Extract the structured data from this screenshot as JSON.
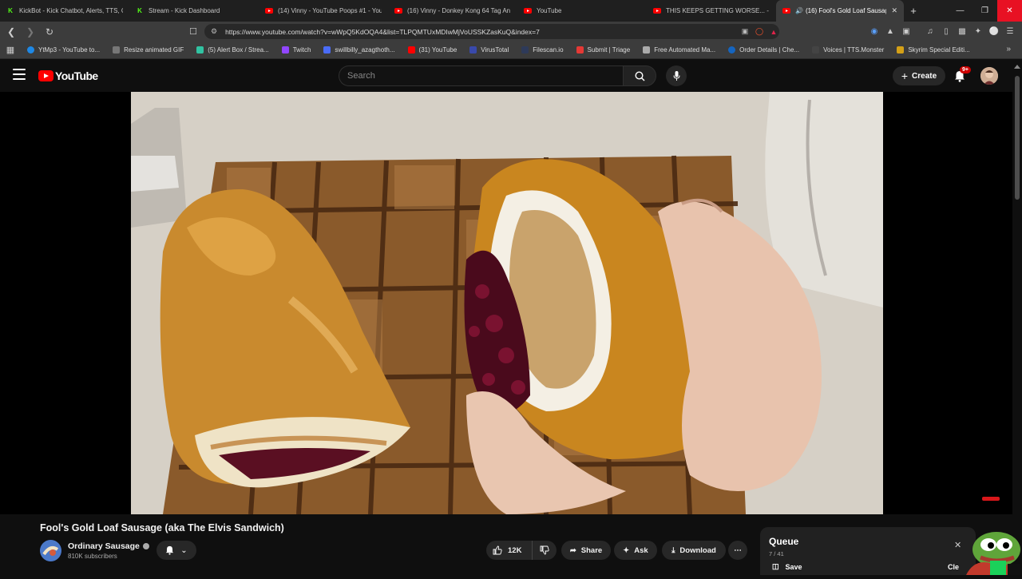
{
  "browser": {
    "tabs": [
      {
        "title": "KickBot - Kick Chatbot, Alerts, TTS, C",
        "icon": "kick-icon",
        "color": "#53fc18",
        "active": false
      },
      {
        "title": "Stream - Kick Dashboard",
        "icon": "kick-icon",
        "color": "#53fc18",
        "active": false
      },
      {
        "title": "(14) Vinny - YouTube Poops #1 - You",
        "icon": "youtube-icon",
        "color": "#ff0000",
        "active": false
      },
      {
        "title": "(16) Vinny - Donkey Kong 64 Tag An",
        "icon": "youtube-icon",
        "color": "#ff0000",
        "active": false
      },
      {
        "title": "YouTube",
        "icon": "youtube-icon",
        "color": "#ff0000",
        "active": false
      },
      {
        "title": "THIS KEEPS GETTING WORSE... - You",
        "icon": "youtube-icon",
        "color": "#ff0000",
        "active": false
      },
      {
        "title": "(16) Fool's Gold Loaf Sausag",
        "icon": "youtube-icon",
        "color": "#ff0000",
        "active": true
      }
    ],
    "url": "https://www.youtube.com/watch?v=wWpQ5KdOQA4&list=TLPQMTUxMDIwMjVoUSSKZasKuQ&index=7",
    "bookmarks": [
      {
        "label": "YtMp3 - YouTube to...",
        "color": "#1e88e5"
      },
      {
        "label": "Resize animated GIF",
        "color": "#777777"
      },
      {
        "label": "(5) Alert Box / Strea...",
        "color": "#31c3a2"
      },
      {
        "label": "Twitch",
        "color": "#9146ff"
      },
      {
        "label": "swillbilly_azagthoth...",
        "color": "#4a6cf7"
      },
      {
        "label": "(31) YouTube",
        "color": "#ff0000"
      },
      {
        "label": "VirusTotal",
        "color": "#3949ab"
      },
      {
        "label": "Filescan.io",
        "color": "#2e3a59"
      },
      {
        "label": "Submit | Triage",
        "color": "#e53935"
      },
      {
        "label": "Free Automated Ma...",
        "color": "#aaaaaa"
      },
      {
        "label": "Order Details | Che...",
        "color": "#1565c0"
      },
      {
        "label": "Voices | TTS.Monster",
        "color": "#444444"
      },
      {
        "label": "Skyrim Special Editi...",
        "color": "#d4a017"
      }
    ]
  },
  "youtube": {
    "logo_text": "YouTube",
    "search_placeholder": "Search",
    "create_label": "Create",
    "notification_badge": "9+"
  },
  "video": {
    "title": "Fool's Gold Loaf Sausage (aka The Elvis Sandwich)",
    "channel": "Ordinary Sausage",
    "subscribers": "810K subscribers",
    "likes": "12K",
    "share_label": "Share",
    "ask_label": "Ask",
    "download_label": "Download"
  },
  "queue": {
    "title": "Queue",
    "count": "7 / 41",
    "save_label": "Save",
    "clear_label": "Cle"
  }
}
